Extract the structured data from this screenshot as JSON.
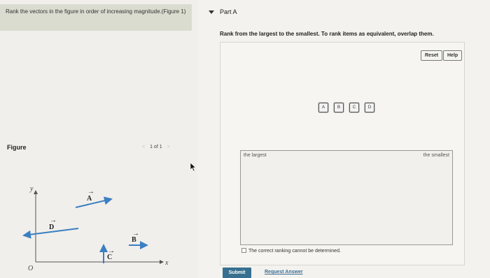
{
  "question": {
    "text": "Rank the vectors in the figure in order of increasing magnitude.(Figure 1)"
  },
  "figure": {
    "heading": "Figure",
    "pager": "1 of 1",
    "axes": {
      "y": "y",
      "x": "x",
      "origin": "O"
    },
    "vectors": [
      "A",
      "B",
      "C",
      "D"
    ]
  },
  "part": {
    "title": "Part A",
    "instructions": "Rank from the largest to the smallest. To rank items as equivalent, overlap them."
  },
  "toolbar": {
    "reset": "Reset",
    "help": "Help"
  },
  "chips": [
    "A",
    "B",
    "C",
    "D"
  ],
  "drop_zone": {
    "left_label": "the largest",
    "right_label": "the smallest"
  },
  "checkbox_label": "The correct ranking cannot be determined.",
  "actions": {
    "submit": "Submit",
    "request_answer": "Request Answer"
  },
  "colors": {
    "vector": "#3b7fc2",
    "submit": "#37708f",
    "question_bg": "#d9dccf"
  }
}
